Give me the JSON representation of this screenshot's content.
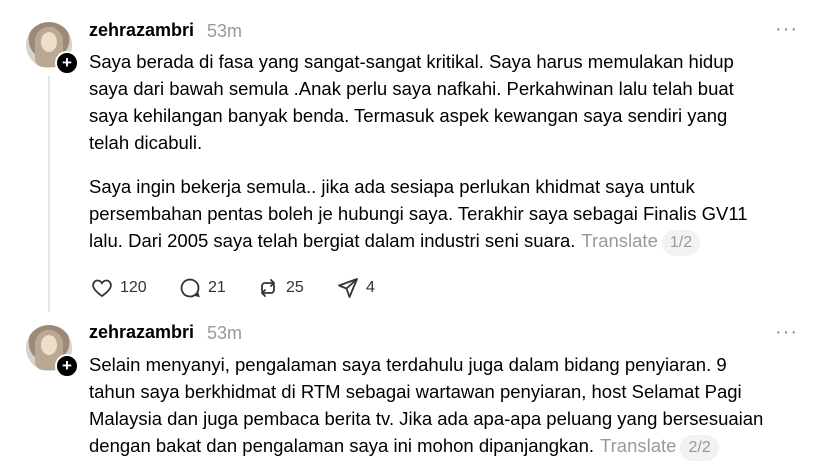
{
  "posts": [
    {
      "username": "zehrazambri",
      "time": "53m",
      "more": "···",
      "paragraphs": [
        [
          "Saya berada di fasa yang sangat-sangat kritikal. Saya harus memulakan hidup",
          "saya dari bawah semula .Anak perlu saya nafkahi. Perkahwinan lalu telah buat",
          "saya kehilangan banyak benda. Termasuk aspek kewangan saya sendiri yang",
          "telah dicabuli."
        ],
        [
          "Saya ingin bekerja semula.. jika ada sesiapa perlukan khidmat saya untuk",
          "persembahan pentas boleh je hubungi saya. Terakhir saya sebagai Finalis GV11",
          "lalu. Dari 2005 saya telah bergiat dalam industri seni suara."
        ]
      ],
      "translate_label": "Translate",
      "page_indicator": "1/2",
      "actions": {
        "likes": "120",
        "replies": "21",
        "reposts": "25",
        "shares": "4"
      }
    },
    {
      "username": "zehrazambri",
      "time": "53m",
      "more": "···",
      "lines": [
        "Selain menyanyi, pengalaman saya terdahulu juga dalam bidang penyiaran. 9",
        "tahun saya berkhidmat di RTM sebagai wartawan penyiaran, host Selamat Pagi",
        "Malaysia dan juga pembaca berita tv. Jika ada apa-apa peluang yang bersesuaian",
        "dengan bakat dan pengalaman saya ini mohon dipanjangkan."
      ],
      "translate_label": "Translate",
      "page_indicator": "2/2"
    }
  ],
  "icons": [
    "heart-icon",
    "comment-icon",
    "repost-icon",
    "share-icon",
    "follow-plus-icon",
    "more-options-icon"
  ]
}
